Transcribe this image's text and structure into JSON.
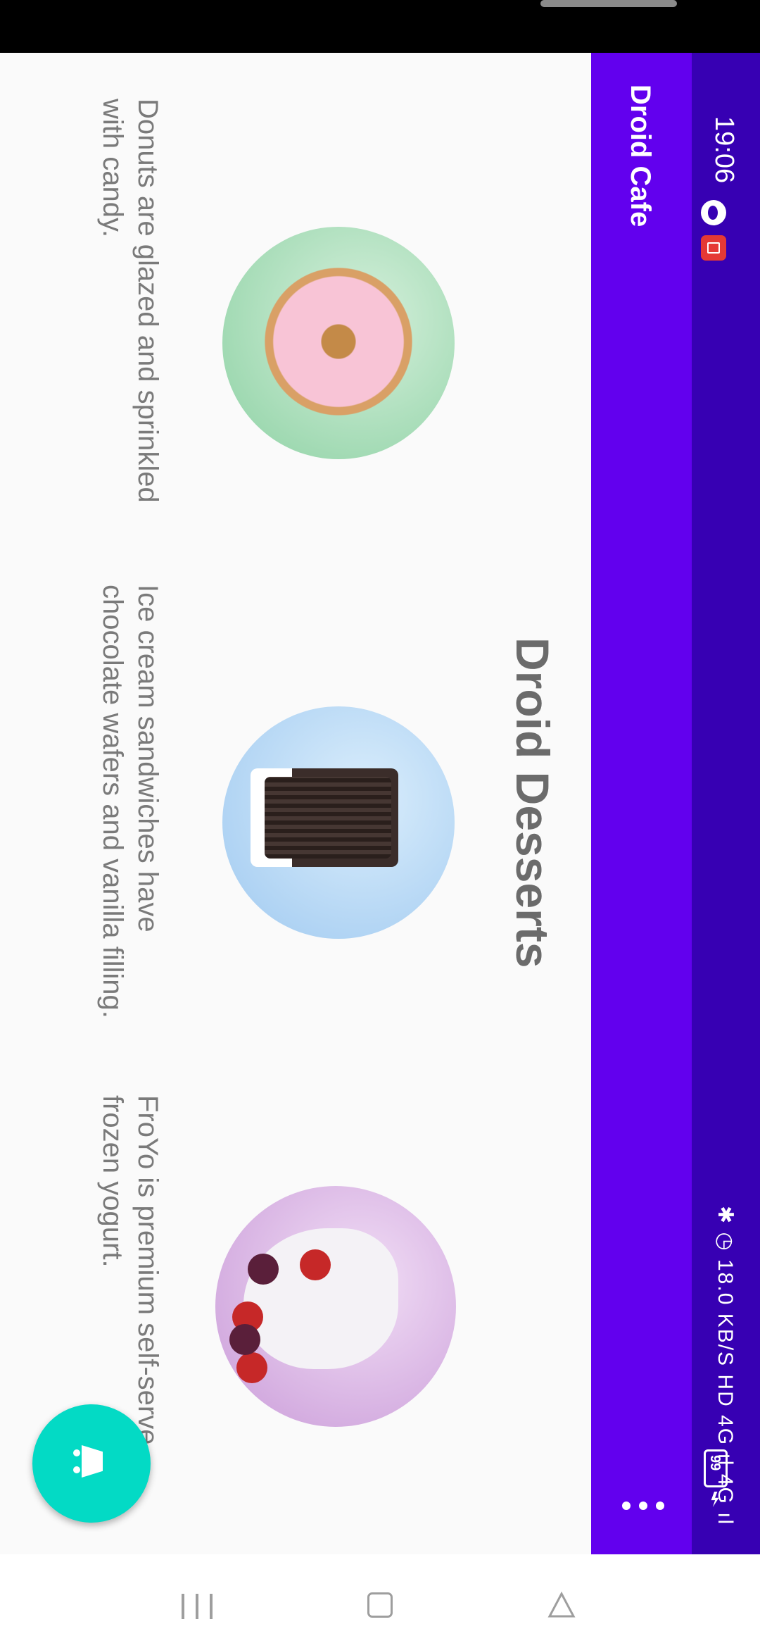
{
  "status_bar": {
    "time": "19:06",
    "right_indicators": "✱ ◷ 18.0 KB/S HD 4G ıl 4G ıl",
    "battery": "99"
  },
  "app_bar": {
    "title": "Droid Cafe",
    "overflow_icon": "more-vert-icon"
  },
  "main": {
    "heading": "Droid Desserts",
    "items": [
      {
        "image": "donut",
        "description": "Donuts are glazed and sprinkled with candy."
      },
      {
        "image": "ice-cream-sandwich",
        "description": "Ice cream sandwiches have chocolate wafers and vanilla filling."
      },
      {
        "image": "froyo",
        "description": "FroYo is premium self-serve frozen yogurt."
      }
    ]
  },
  "fab": {
    "icon": "shopping-cart-icon"
  },
  "nav_bar": {
    "recent": "recent-apps-icon",
    "home": "home-icon",
    "back": "back-icon"
  },
  "colors": {
    "primary": "#6200ee",
    "primary_dark": "#3700b3",
    "accent": "#03dac5"
  }
}
